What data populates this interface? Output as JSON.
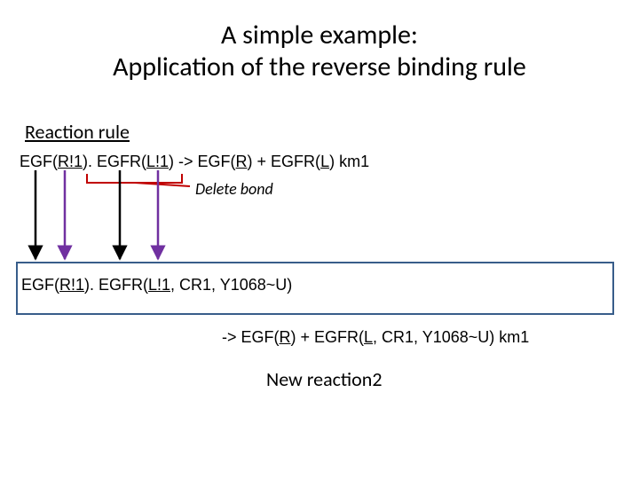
{
  "title_line1": "A simple example:",
  "title_line2": "Application of the reverse binding rule",
  "section_heading": "Reaction rule",
  "rule_top": {
    "p1": "EGF(",
    "p2": "R!1",
    "p3": "). EGFR(",
    "p4": "L!1",
    "p5": ") -> EGF(",
    "p6": "R",
    "p7": ") + EGFR(",
    "p8": "L",
    "p9": ") km1"
  },
  "delete_label": "Delete bond",
  "rule_box": {
    "p1": "EGF(",
    "p2": "R!1",
    "p3": "). EGFR(",
    "p4": "L!1",
    "p5": ", CR1, Y1068~U)"
  },
  "rule_result": {
    "p1": "-> EGF(",
    "p2": "R",
    "p3": ") + EGFR(",
    "p4": "L",
    "p5": ", CR1, Y1068~U) km1"
  },
  "new_reaction_label": "New reaction2",
  "arrows": {
    "delete_ul_color": "#c00000",
    "a1_color": "#000000",
    "a2_color": "#7030a0",
    "a3_color": "#000000",
    "a4_color": "#7030a0"
  }
}
